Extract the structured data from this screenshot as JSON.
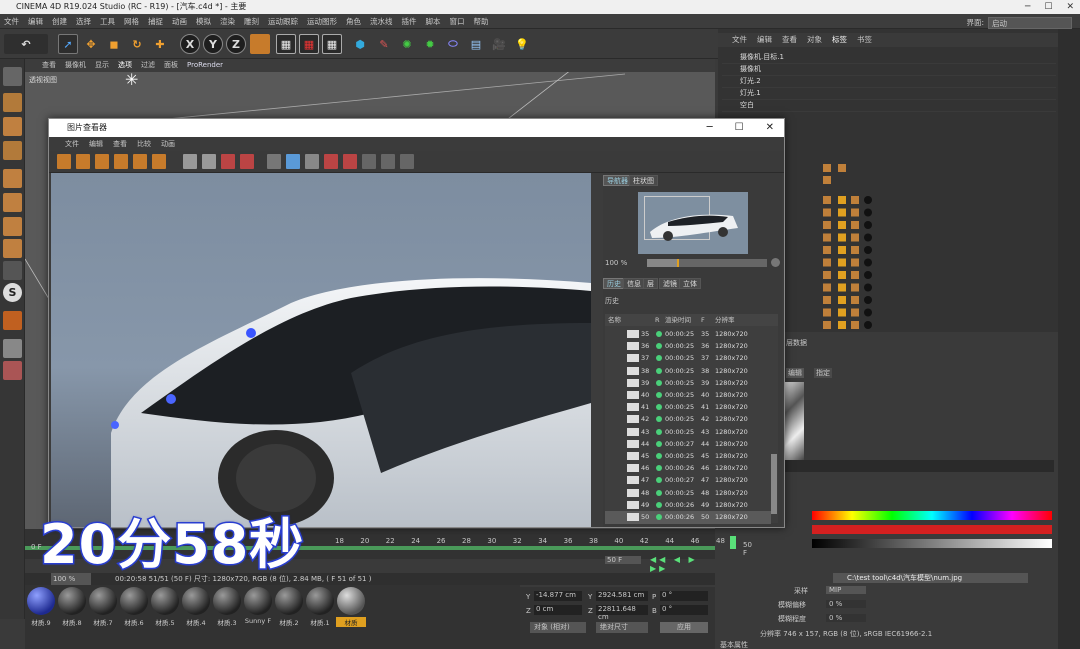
{
  "window": {
    "title": "CINEMA 4D R19.024 Studio (RC - R19) - [汽车.c4d *] - 主要"
  },
  "menubar": {
    "items": [
      "文件",
      "编辑",
      "创建",
      "选择",
      "工具",
      "网格",
      "捕捉",
      "动画",
      "模拟",
      "渲染",
      "雕刻",
      "运动跟踪",
      "运动图形",
      "角色",
      "流水线",
      "插件",
      "脚本",
      "窗口",
      "帮助"
    ],
    "layout_label": "界面:",
    "layout_value": "启动"
  },
  "viewport": {
    "menu": [
      "查看",
      "摄像机",
      "显示",
      "选项",
      "过滤",
      "面板",
      "ProRender"
    ],
    "label": "透视视图"
  },
  "object_manager": {
    "menu": [
      "文件",
      "编辑",
      "查看",
      "对象",
      "标签",
      "书签"
    ],
    "rows": [
      "摄像机.目标.1",
      "摄像机",
      "灯光.2",
      "灯光.1",
      "空白"
    ]
  },
  "picture_viewer": {
    "title": "图片查看器",
    "menu": [
      "文件",
      "编辑",
      "查看",
      "比较",
      "动画"
    ],
    "nav_tabs": [
      "导航器",
      "柱状图"
    ],
    "zoom": "100 %",
    "hist_tabs": [
      "历史",
      "信息",
      "层",
      "滤镜",
      "立体"
    ],
    "hist_label": "历史",
    "columns": [
      "名称",
      "R",
      "渲染时间",
      "F",
      "分辨率"
    ],
    "rows": [
      {
        "n": "35",
        "t": "00:00:25",
        "f": "35",
        "r": "1280x720"
      },
      {
        "n": "36",
        "t": "00:00:25",
        "f": "36",
        "r": "1280x720"
      },
      {
        "n": "37",
        "t": "00:00:25",
        "f": "37",
        "r": "1280x720"
      },
      {
        "n": "38",
        "t": "00:00:25",
        "f": "38",
        "r": "1280x720"
      },
      {
        "n": "39",
        "t": "00:00:25",
        "f": "39",
        "r": "1280x720"
      },
      {
        "n": "40",
        "t": "00:00:25",
        "f": "40",
        "r": "1280x720"
      },
      {
        "n": "41",
        "t": "00:00:25",
        "f": "41",
        "r": "1280x720"
      },
      {
        "n": "42",
        "t": "00:00:25",
        "f": "42",
        "r": "1280x720"
      },
      {
        "n": "43",
        "t": "00:00:25",
        "f": "43",
        "r": "1280x720"
      },
      {
        "n": "44",
        "t": "00:00:27",
        "f": "44",
        "r": "1280x720"
      },
      {
        "n": "45",
        "t": "00:00:25",
        "f": "45",
        "r": "1280x720"
      },
      {
        "n": "46",
        "t": "00:00:26",
        "f": "46",
        "r": "1280x720"
      },
      {
        "n": "47",
        "t": "00:00:27",
        "f": "47",
        "r": "1280x720"
      },
      {
        "n": "48",
        "t": "00:00:25",
        "f": "48",
        "r": "1280x720"
      },
      {
        "n": "49",
        "t": "00:00:26",
        "f": "49",
        "r": "1280x720"
      },
      {
        "n": "50",
        "t": "00:00:26",
        "f": "50",
        "r": "1280x720"
      }
    ],
    "status": "00:20:58 51/51 (50 F)    尺寸: 1280x720, RGB (8 位), 2.84 MB,  ( F 51 of 51 )",
    "status_zoom": "100 %"
  },
  "overlay": {
    "text": "20分58秒"
  },
  "timeline": {
    "ticks": [
      "18",
      "20",
      "22",
      "24",
      "26",
      "28",
      "30",
      "32",
      "34",
      "36",
      "38",
      "40",
      "42",
      "44",
      "46",
      "48"
    ],
    "end_frame": "50 F",
    "start_frame": "0 F",
    "frame_field": "50 F"
  },
  "materials": {
    "labels": [
      "材质.9",
      "材质.8",
      "材质.7",
      "材质.6",
      "材质.5",
      "材质.4",
      "材质.3",
      "Sunny F",
      "材质.2",
      "材质.1",
      "材质"
    ]
  },
  "coords": {
    "y_pos": "-14.877 cm",
    "z_pos": "0 cm",
    "y_size": "2924.581 cm",
    "z_size": "22811.648 cm",
    "p_rot": "0 °",
    "b_rot": "0 °",
    "mode1": "对象 (相对)",
    "mode2": "绝对尺寸",
    "apply": "应用"
  },
  "attributes": {
    "tabs": [
      "编辑",
      "指定"
    ],
    "header": "层数据",
    "path": "C:\\test tool\\c4d\\汽车模型\\num.jpg",
    "sampling_label": "采样",
    "sampling_value": "MIP",
    "blur_offset_label": "模糊偏移",
    "blur_offset_value": "0 %",
    "blur_scale_label": "模糊程度",
    "blur_scale_value": "0 %",
    "resolution": "分辨率 746 x 157, RGB (8 位), sRGB IEC61966-2.1",
    "bottom_label": "基本属性"
  },
  "colors": {
    "accent": "#2a3fd0",
    "green": "#4ad07a",
    "panel": "#3a3a3a"
  }
}
